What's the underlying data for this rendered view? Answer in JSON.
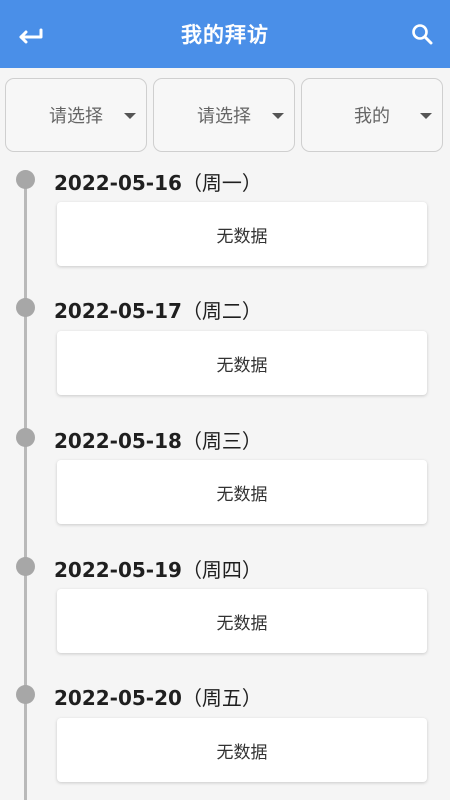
{
  "header": {
    "title": "我的拜访",
    "back_icon": "arrow-left-icon",
    "search_icon": "search-icon"
  },
  "filters": [
    {
      "label": "请选择"
    },
    {
      "label": "请选择"
    },
    {
      "label": "我的"
    }
  ],
  "days": [
    {
      "date": "2022-05-16",
      "weekday": "（周一）",
      "empty_text": "无数据"
    },
    {
      "date": "2022-05-17",
      "weekday": "（周二）",
      "empty_text": "无数据"
    },
    {
      "date": "2022-05-18",
      "weekday": "（周三）",
      "empty_text": "无数据"
    },
    {
      "date": "2022-05-19",
      "weekday": "（周四）",
      "empty_text": "无数据"
    },
    {
      "date": "2022-05-20",
      "weekday": "（周五）",
      "empty_text": "无数据"
    }
  ],
  "colors": {
    "accent": "#4a8fe8",
    "timeline_dot": "#a7a7a7",
    "timeline_line": "#b9b9b9"
  }
}
